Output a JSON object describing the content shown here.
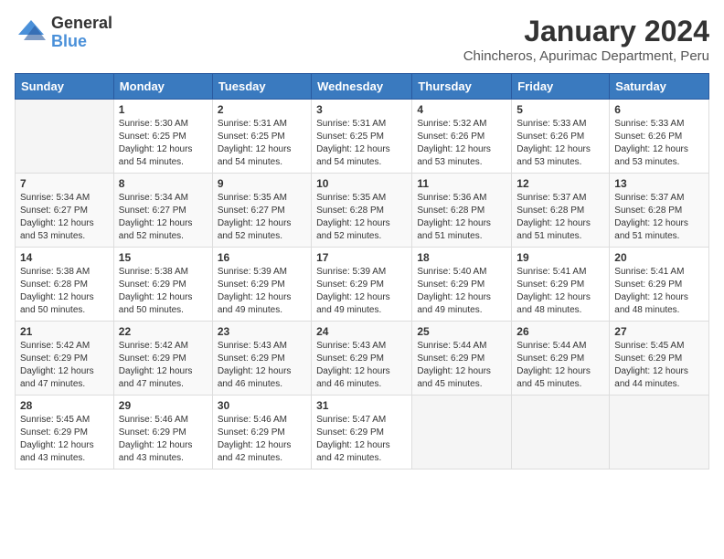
{
  "logo": {
    "general": "General",
    "blue": "Blue"
  },
  "title": "January 2024",
  "subtitle": "Chincheros, Apurimac Department, Peru",
  "days_header": [
    "Sunday",
    "Monday",
    "Tuesday",
    "Wednesday",
    "Thursday",
    "Friday",
    "Saturday"
  ],
  "weeks": [
    [
      {
        "day": "",
        "info": ""
      },
      {
        "day": "1",
        "info": "Sunrise: 5:30 AM\nSunset: 6:25 PM\nDaylight: 12 hours\nand 54 minutes."
      },
      {
        "day": "2",
        "info": "Sunrise: 5:31 AM\nSunset: 6:25 PM\nDaylight: 12 hours\nand 54 minutes."
      },
      {
        "day": "3",
        "info": "Sunrise: 5:31 AM\nSunset: 6:25 PM\nDaylight: 12 hours\nand 54 minutes."
      },
      {
        "day": "4",
        "info": "Sunrise: 5:32 AM\nSunset: 6:26 PM\nDaylight: 12 hours\nand 53 minutes."
      },
      {
        "day": "5",
        "info": "Sunrise: 5:33 AM\nSunset: 6:26 PM\nDaylight: 12 hours\nand 53 minutes."
      },
      {
        "day": "6",
        "info": "Sunrise: 5:33 AM\nSunset: 6:26 PM\nDaylight: 12 hours\nand 53 minutes."
      }
    ],
    [
      {
        "day": "7",
        "info": "Sunrise: 5:34 AM\nSunset: 6:27 PM\nDaylight: 12 hours\nand 53 minutes."
      },
      {
        "day": "8",
        "info": "Sunrise: 5:34 AM\nSunset: 6:27 PM\nDaylight: 12 hours\nand 52 minutes."
      },
      {
        "day": "9",
        "info": "Sunrise: 5:35 AM\nSunset: 6:27 PM\nDaylight: 12 hours\nand 52 minutes."
      },
      {
        "day": "10",
        "info": "Sunrise: 5:35 AM\nSunset: 6:28 PM\nDaylight: 12 hours\nand 52 minutes."
      },
      {
        "day": "11",
        "info": "Sunrise: 5:36 AM\nSunset: 6:28 PM\nDaylight: 12 hours\nand 51 minutes."
      },
      {
        "day": "12",
        "info": "Sunrise: 5:37 AM\nSunset: 6:28 PM\nDaylight: 12 hours\nand 51 minutes."
      },
      {
        "day": "13",
        "info": "Sunrise: 5:37 AM\nSunset: 6:28 PM\nDaylight: 12 hours\nand 51 minutes."
      }
    ],
    [
      {
        "day": "14",
        "info": "Sunrise: 5:38 AM\nSunset: 6:28 PM\nDaylight: 12 hours\nand 50 minutes."
      },
      {
        "day": "15",
        "info": "Sunrise: 5:38 AM\nSunset: 6:29 PM\nDaylight: 12 hours\nand 50 minutes."
      },
      {
        "day": "16",
        "info": "Sunrise: 5:39 AM\nSunset: 6:29 PM\nDaylight: 12 hours\nand 49 minutes."
      },
      {
        "day": "17",
        "info": "Sunrise: 5:39 AM\nSunset: 6:29 PM\nDaylight: 12 hours\nand 49 minutes."
      },
      {
        "day": "18",
        "info": "Sunrise: 5:40 AM\nSunset: 6:29 PM\nDaylight: 12 hours\nand 49 minutes."
      },
      {
        "day": "19",
        "info": "Sunrise: 5:41 AM\nSunset: 6:29 PM\nDaylight: 12 hours\nand 48 minutes."
      },
      {
        "day": "20",
        "info": "Sunrise: 5:41 AM\nSunset: 6:29 PM\nDaylight: 12 hours\nand 48 minutes."
      }
    ],
    [
      {
        "day": "21",
        "info": "Sunrise: 5:42 AM\nSunset: 6:29 PM\nDaylight: 12 hours\nand 47 minutes."
      },
      {
        "day": "22",
        "info": "Sunrise: 5:42 AM\nSunset: 6:29 PM\nDaylight: 12 hours\nand 47 minutes."
      },
      {
        "day": "23",
        "info": "Sunrise: 5:43 AM\nSunset: 6:29 PM\nDaylight: 12 hours\nand 46 minutes."
      },
      {
        "day": "24",
        "info": "Sunrise: 5:43 AM\nSunset: 6:29 PM\nDaylight: 12 hours\nand 46 minutes."
      },
      {
        "day": "25",
        "info": "Sunrise: 5:44 AM\nSunset: 6:29 PM\nDaylight: 12 hours\nand 45 minutes."
      },
      {
        "day": "26",
        "info": "Sunrise: 5:44 AM\nSunset: 6:29 PM\nDaylight: 12 hours\nand 45 minutes."
      },
      {
        "day": "27",
        "info": "Sunrise: 5:45 AM\nSunset: 6:29 PM\nDaylight: 12 hours\nand 44 minutes."
      }
    ],
    [
      {
        "day": "28",
        "info": "Sunrise: 5:45 AM\nSunset: 6:29 PM\nDaylight: 12 hours\nand 43 minutes."
      },
      {
        "day": "29",
        "info": "Sunrise: 5:46 AM\nSunset: 6:29 PM\nDaylight: 12 hours\nand 43 minutes."
      },
      {
        "day": "30",
        "info": "Sunrise: 5:46 AM\nSunset: 6:29 PM\nDaylight: 12 hours\nand 42 minutes."
      },
      {
        "day": "31",
        "info": "Sunrise: 5:47 AM\nSunset: 6:29 PM\nDaylight: 12 hours\nand 42 minutes."
      },
      {
        "day": "",
        "info": ""
      },
      {
        "day": "",
        "info": ""
      },
      {
        "day": "",
        "info": ""
      }
    ]
  ]
}
